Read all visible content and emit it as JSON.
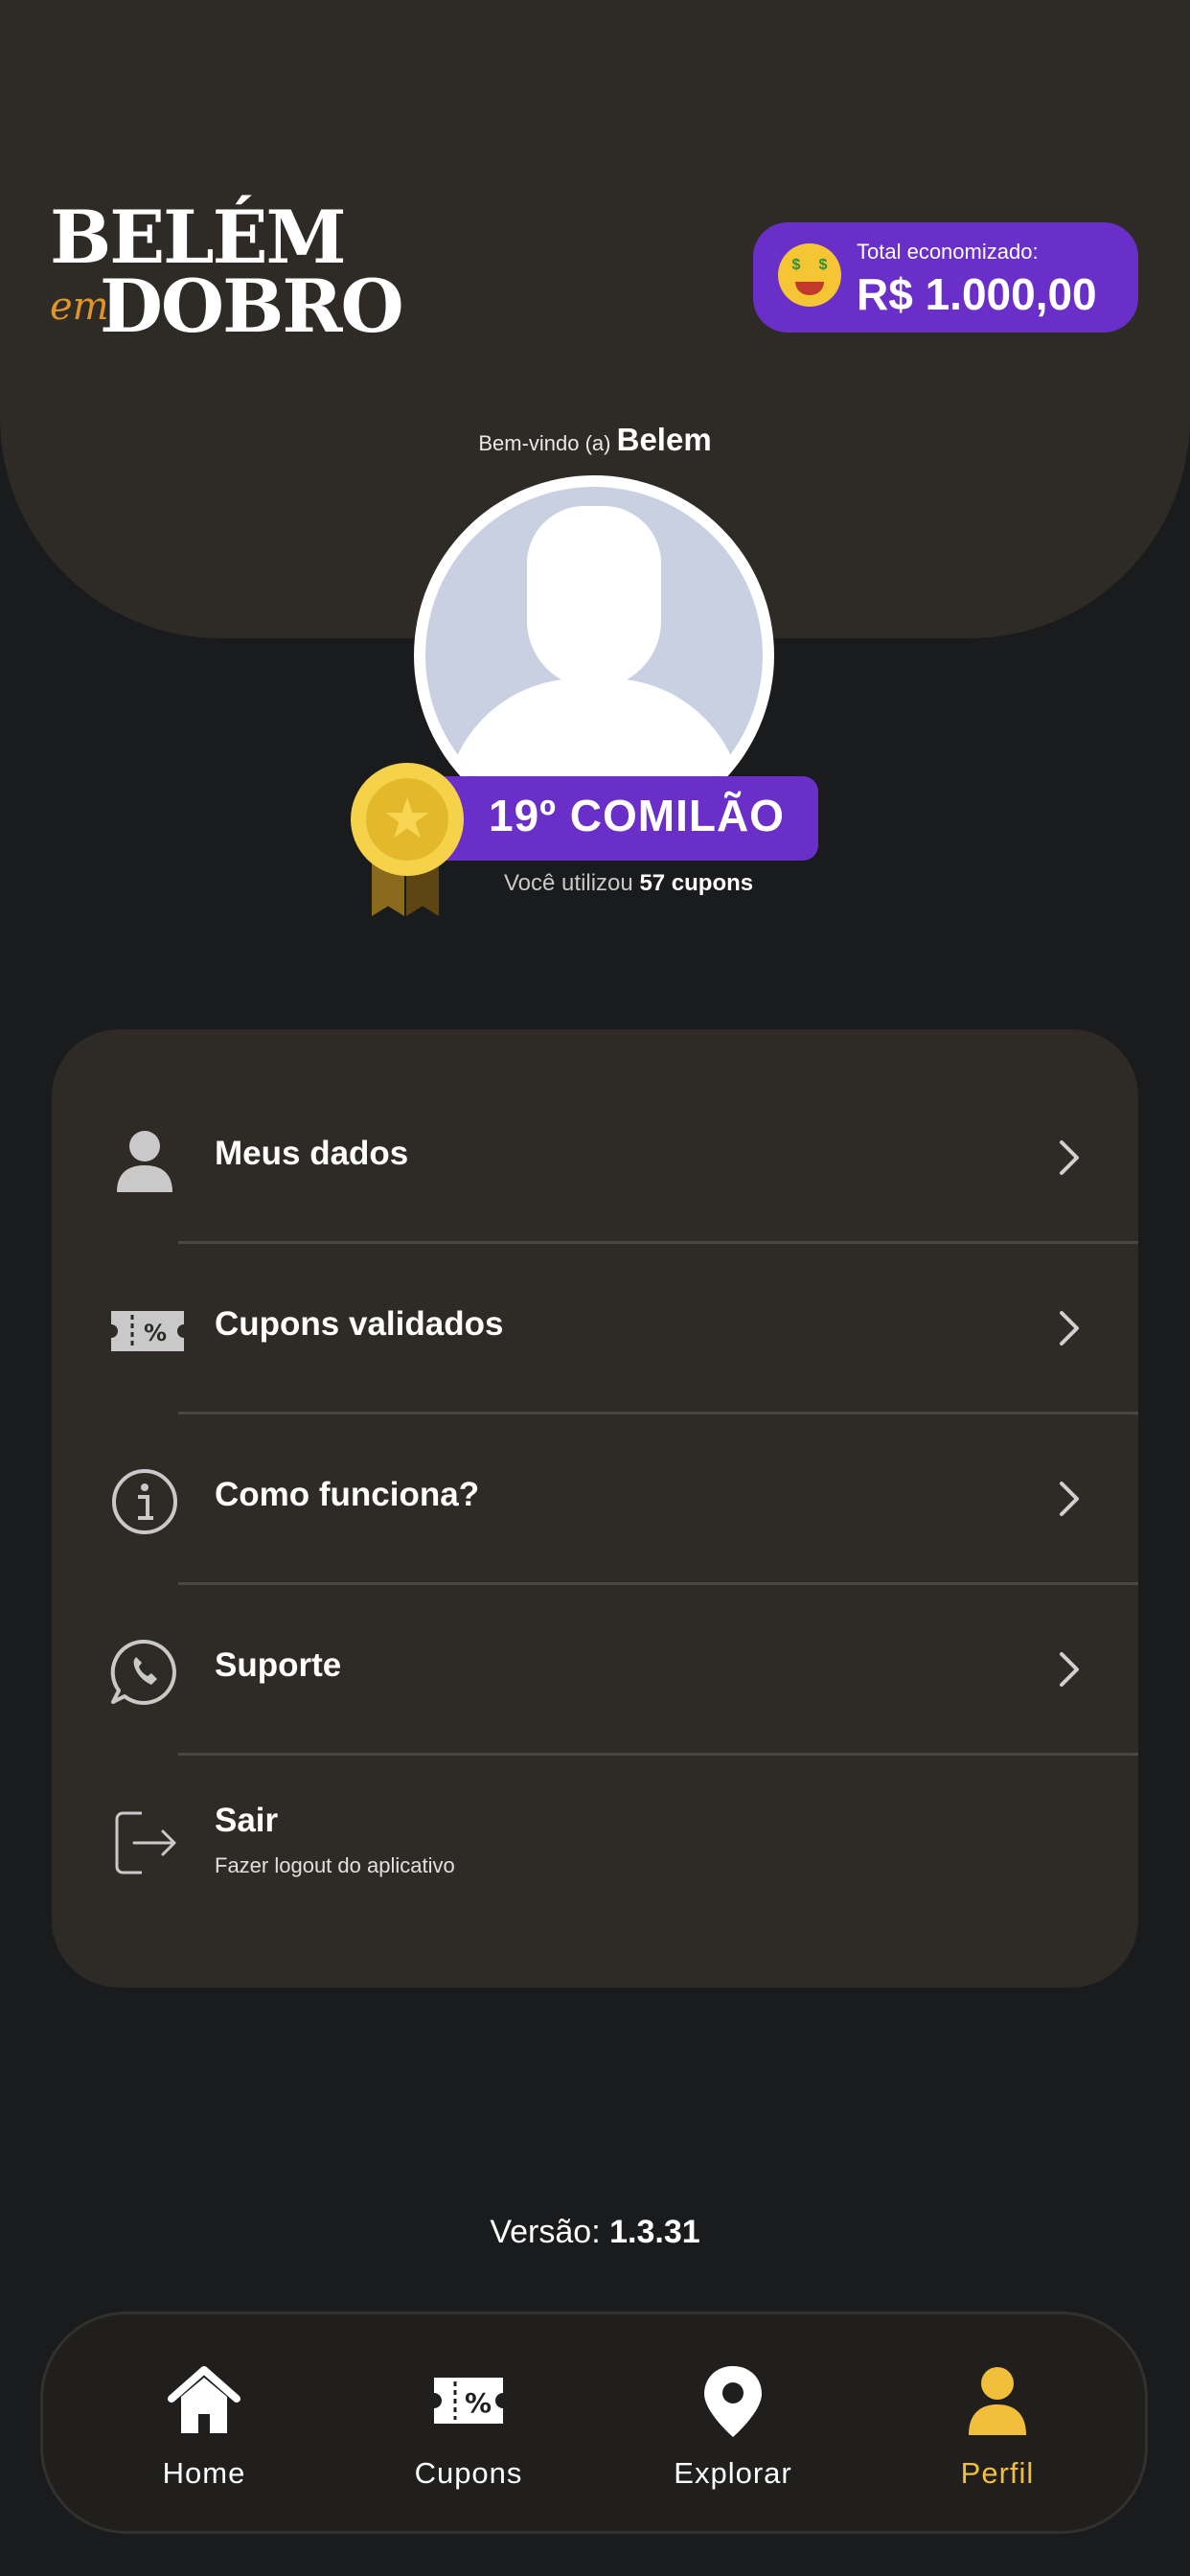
{
  "header": {
    "logo_top": "BELÉM",
    "logo_em": "em",
    "logo_bottom": "DOBRO",
    "savings_label": "Total economizado:",
    "savings_value": "R$ 1.000,00",
    "savings_icon": "money-mouth-face-emoji"
  },
  "profile": {
    "welcome_prefix": "Bem-vindo (a)",
    "user_name": "Belem",
    "rank": "19º COMILÃO",
    "coupons_prefix": "Você utilizou",
    "coupons_count": "57 cupons"
  },
  "menu": {
    "items": [
      {
        "label": "Meus dados",
        "icon": "user-icon"
      },
      {
        "label": "Cupons validados",
        "icon": "coupon-icon"
      },
      {
        "label": "Como funciona?",
        "icon": "info-icon"
      },
      {
        "label": "Suporte",
        "icon": "whatsapp-icon"
      },
      {
        "label": "Sair",
        "sub": "Fazer logout do aplicativo",
        "icon": "logout-icon"
      }
    ]
  },
  "footer": {
    "version_label": "Versão:",
    "version_value": "1.3.31"
  },
  "tabbar": {
    "tabs": [
      {
        "label": "Home",
        "icon": "home-icon"
      },
      {
        "label": "Cupons",
        "icon": "coupon-icon"
      },
      {
        "label": "Explorar",
        "icon": "map-pin-icon"
      },
      {
        "label": "Perfil",
        "icon": "user-icon"
      }
    ],
    "active_index": 3
  },
  "colors": {
    "background": "#1a1b1d",
    "card": "#2e2b27",
    "accent_purple": "#6a2fc8",
    "accent_gold": "#f2bf3c",
    "logo_orange": "#e0952b"
  }
}
